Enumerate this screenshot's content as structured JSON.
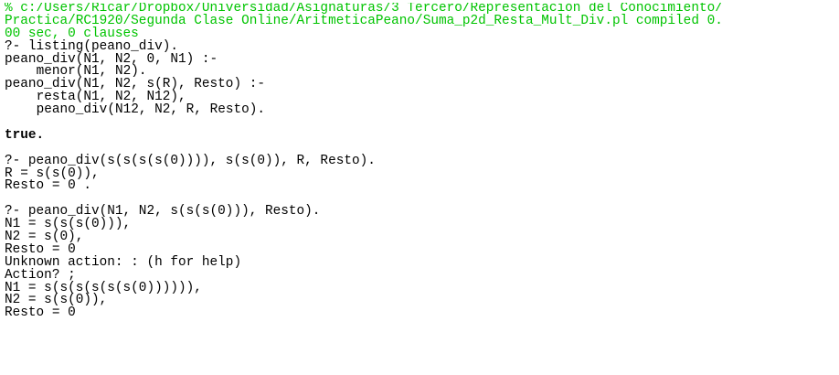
{
  "colors": {
    "background": "#ffffff",
    "text": "#000000",
    "comment": "#00c400"
  },
  "console": {
    "compile_msg": [
      "% c:/Users/Ricar/Dropbox/Universidad/Asignaturas/3 Tercero/Representación del Conocimiento/",
      "Practica/RC1920/Segunda Clase Online/AritmeticaPeano/Suma_p2d_Resta_Mult_Div.pl compiled 0.",
      "00 sec, 0 clauses"
    ],
    "listing": {
      "query": "?- listing(peano_div).",
      "clause1_head": "peano_div(N1, N2, 0, N1) :-",
      "clause1_body": "menor(N1, N2).",
      "clause2_head": "peano_div(N1, N2, s(R), Resto) :-",
      "clause2_body1": "resta(N1, N2, N12),",
      "clause2_body2": "peano_div(N12, N2, R, Resto).",
      "result": "true."
    },
    "query2": {
      "query": "?- peano_div(s(s(s(s(0)))), s(s(0)), R, Resto).",
      "r": "R = s(s(0)),",
      "resto": "Resto = 0 ."
    },
    "query3": {
      "query": "?- peano_div(N1, N2, s(s(s(0))), Resto).",
      "sol1_n1": "N1 = s(s(s(0))),",
      "sol1_n2": "N2 = s(0),",
      "sol1_resto": "Resto = 0",
      "unknown": "Unknown action: : (h for help)",
      "action": "Action? ;",
      "sol2_n1": "N1 = s(s(s(s(s(s(0)))))),",
      "sol2_n2": "N2 = s(s(0)),",
      "sol2_resto": "Resto = 0"
    }
  }
}
